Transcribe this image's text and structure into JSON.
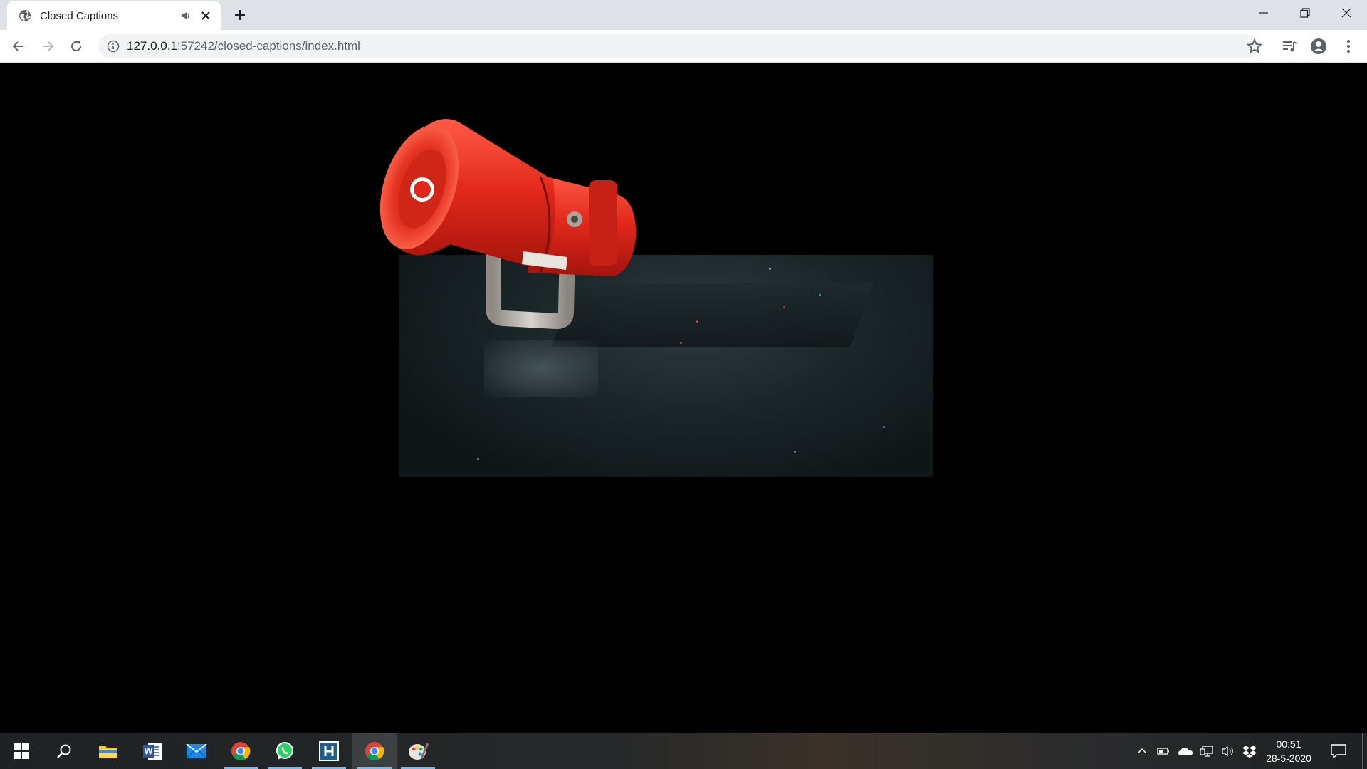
{
  "tab": {
    "title": "Closed Captions"
  },
  "address_bar": {
    "host": "127.0.0.1",
    "path": ":57242/closed-captions/index.html"
  },
  "taskbar": {
    "time": "00:51",
    "date": "28-5-2020"
  },
  "colors": {
    "siren_red": "#e0271b",
    "video_bg": "#1b2628",
    "taskbar_accent": "#76b9ed"
  }
}
